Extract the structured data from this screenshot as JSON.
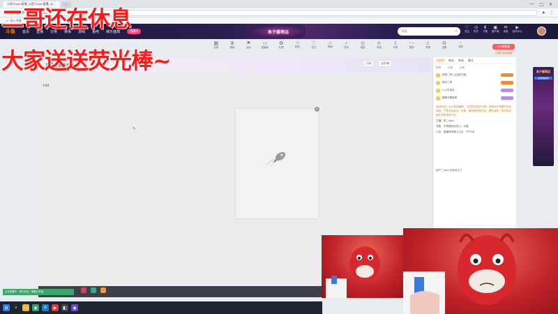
{
  "browser": {
    "tabs": [
      "斗鱼二hyun直播_斗鱼二hyun直播_斗…",
      ""
    ],
    "url": "douyu.com",
    "bookmark": "导入书签"
  },
  "site": {
    "logo": "斗鱼",
    "nav": [
      "首页",
      "直播",
      "分类",
      "赛事",
      "游戏",
      "鱼吧",
      "娱乐盛典"
    ],
    "live_badge": "直播中",
    "event": "鱼子酱萌运",
    "search_placeholder": "搜索",
    "user_icons": [
      "关注",
      "历史",
      "下载",
      "客户端",
      "消息",
      "创作中心"
    ]
  },
  "toolbar": {
    "items": [
      "分类",
      "赛事",
      "活动",
      "直播间",
      "礼物",
      "粉丝",
      "关注",
      "商城",
      "任务",
      "抽奖",
      "贵族",
      "分享",
      "更多",
      "举报",
      "设置",
      "其他"
    ],
    "share_button": "PC端直播",
    "anchor_link": "主播已连续直播"
  },
  "room": {
    "title": "不要看我我在休息",
    "sub": "斗鱼号 · 关注",
    "actions": [
      "订阅",
      "全民嗨"
    ]
  },
  "player": {
    "label": "hdd",
    "cursor": "↖"
  },
  "chat": {
    "tabs": [
      "贡献榜",
      "粉丝",
      "贵族",
      "聊天"
    ],
    "fans_head": [
      "周榜",
      "日榜",
      "总榜"
    ],
    "ranks": [
      {
        "n": "1",
        "name": "前嘅二哥 | 公益防沉迷"
      },
      {
        "n": "2",
        "name": "陈的二哥"
      },
      {
        "n": "3",
        "name": "小火车亲亲"
      },
      {
        "n": "4",
        "name": "偶像不需保姆"
      }
    ],
    "messages": [
      "欢迎来到二hyun的直播间，文明发言遵守法规，鱼吧用户请遵守社区规则，严禁涉及政治、色情、赌博等违规内容，理性消费，请勿轻信刷礼物的诱导行为。",
      "主播：前二hyun",
      "专属：不再想念你的人，共勉",
      "公告：直播时间晚上七点 · 下午3点"
    ],
    "bottom": "用户二hyun 已经关注了"
  },
  "ad": {
    "title": "鱼子酱萌运",
    "sub": "全民嗨起来"
  },
  "bottom": {
    "toast": "正在观看中 · 您已开启 · 弹幕已开启"
  },
  "captions": {
    "line1": "二哥还在休息",
    "line2": "大家送送荧光棒~"
  }
}
